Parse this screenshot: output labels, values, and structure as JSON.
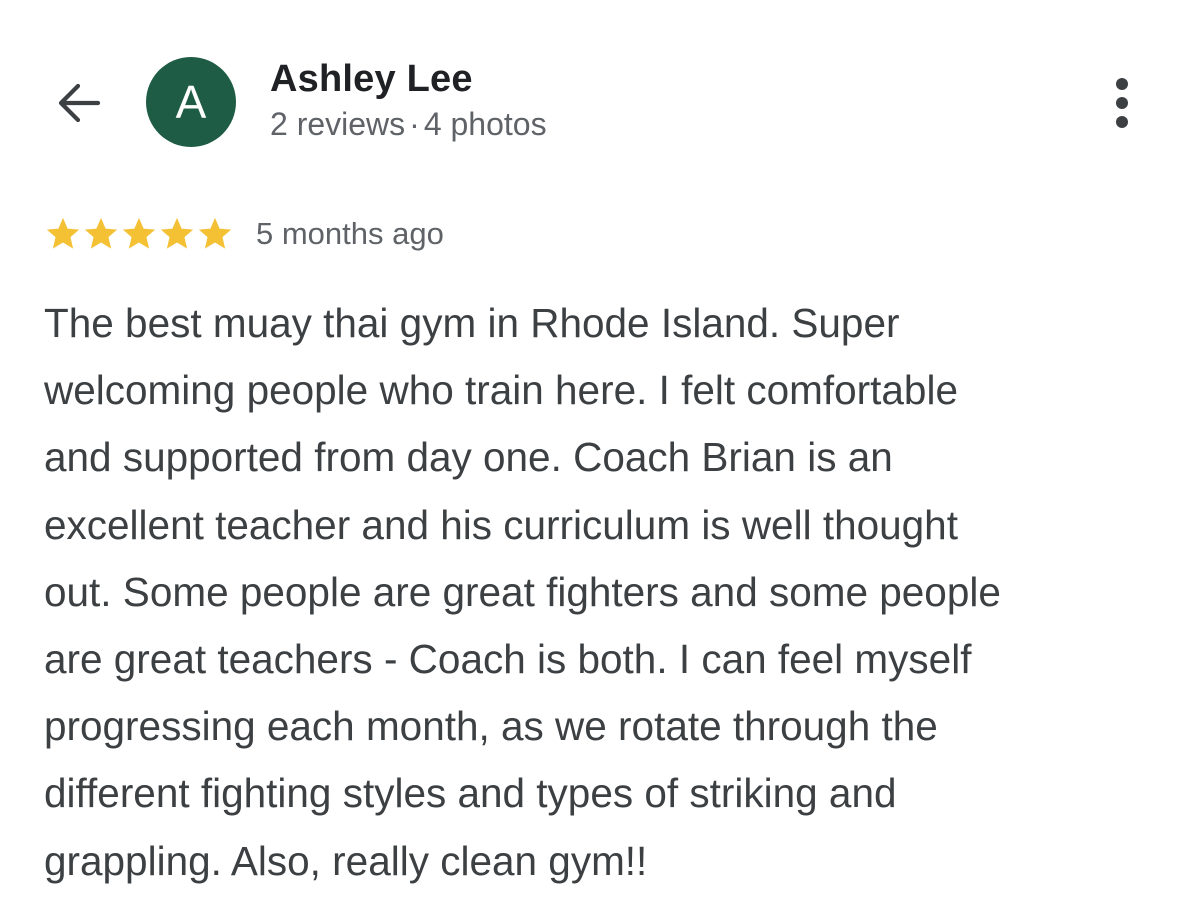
{
  "reviewer": {
    "initial": "A",
    "name": "Ashley Lee",
    "reviews_count": "2 reviews",
    "photos_count": "4 photos",
    "separator": "·",
    "avatar_color": "#1e5c45"
  },
  "icons": {
    "back": "arrow-left-icon",
    "more": "more-vertical-icon",
    "star": "star-icon"
  },
  "review": {
    "rating": 5,
    "rating_max": 5,
    "star_color": "#f4c034",
    "time_ago": "5 months ago",
    "text": "The best muay thai gym in Rhode Island. Super\nwelcoming people who train here. I felt comfortable\nand supported from day one. Coach Brian is an\nexcellent teacher and his curriculum is well thought\nout. Some people are great fighters and some people\nare great teachers - Coach is both. I can feel myself\nprogressing each month, as we rotate through the\ndifferent fighting styles and types of striking and\ngrappling. Also, really clean gym!!"
  }
}
